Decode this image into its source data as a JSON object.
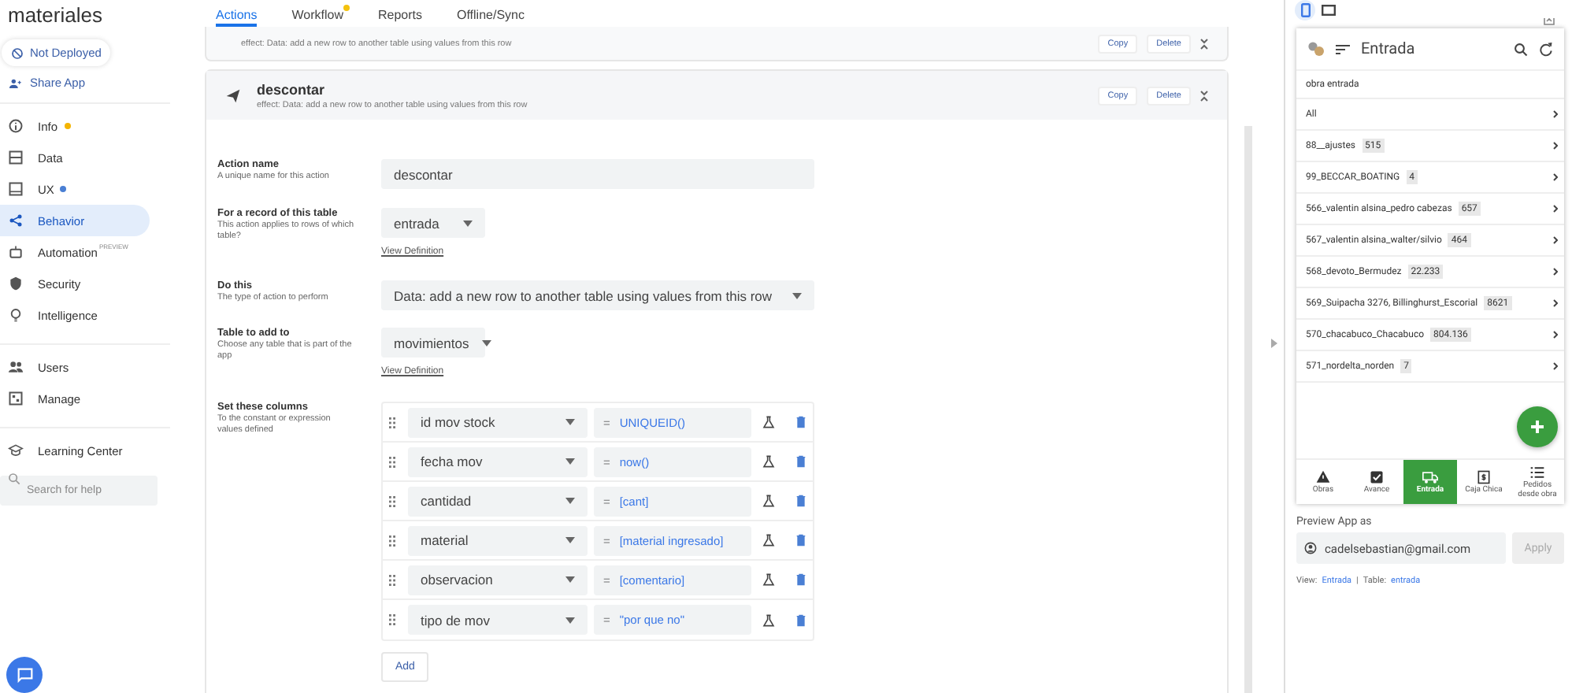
{
  "app_title": "materiales",
  "deploy_status": "Not Deployed",
  "share_label": "Share App",
  "nav_sections": [
    {
      "items": [
        {
          "label": "Info",
          "selected": false,
          "color": "#f4b400"
        },
        {
          "label": "Data",
          "selected": false
        },
        {
          "label": "UX",
          "selected": false,
          "color": "#4a7fd4"
        },
        {
          "label": "Behavior",
          "selected": true
        },
        {
          "label": "Automation",
          "selected": false,
          "tag": "PREVIEW"
        },
        {
          "label": "Security",
          "selected": false
        },
        {
          "label": "Intelligence",
          "selected": false
        }
      ]
    },
    {
      "items": [
        {
          "label": "Users",
          "selected": false
        },
        {
          "label": "Manage",
          "selected": false
        }
      ]
    },
    {
      "items": [
        {
          "label": "Learning Center",
          "selected": false
        }
      ]
    }
  ],
  "help_search": {
    "placeholder": "Search for help"
  },
  "tabs": [
    {
      "label": "Actions",
      "selected": true
    },
    {
      "label": "Workflow",
      "selected": false,
      "color": "#f4c20d"
    },
    {
      "label": "Reports",
      "selected": false
    },
    {
      "label": "Offline/Sync",
      "selected": false
    }
  ],
  "actions": [
    {
      "kind": "collapsed",
      "effect": "effect: Data: add a new row to another table using values from this row",
      "buttons": [
        "Copy",
        "Delete"
      ]
    },
    {
      "kind": "expanded",
      "name": "descontar",
      "effect": "effect: Data: add a new row to another table using values from this row",
      "buttons": [
        "Copy",
        "Delete"
      ],
      "fields": [
        {
          "kind": "text",
          "label": "Action name",
          "hint": "A unique name for this action",
          "value": "descontar"
        },
        {
          "kind": "dropdown",
          "label": "For a record of this table",
          "hint": "This action applies to rows of which table?",
          "value": "entrada",
          "link": "View Definition"
        },
        {
          "kind": "wide-dropdown",
          "label": "Do this",
          "hint": "The type of action to perform",
          "value": "Data: add a new row to another table using values from this row"
        },
        {
          "kind": "dropdown",
          "label": "Table to add to",
          "hint": "Choose any table that is part of the app",
          "value": "movimientos",
          "link": "View Definition"
        },
        {
          "kind": "columns",
          "label": "Set these columns",
          "hint": "To the constant or expression values defined",
          "rows": [
            {
              "column": "id mov stock",
              "operator": "=",
              "value": "UNIQUEID()"
            },
            {
              "column": "fecha mov",
              "operator": "=",
              "value": "now()"
            },
            {
              "column": "cantidad",
              "operator": "=",
              "value": "[cant]"
            },
            {
              "column": "material",
              "operator": "=",
              "value": "[material ingresado]"
            },
            {
              "column": "observacion",
              "operator": "=",
              "value": "[comentario]"
            },
            {
              "column": "tipo de mov",
              "operator": "=",
              "value": "\"por que no\""
            }
          ],
          "add_label": "Add"
        }
      ]
    }
  ],
  "preview": {
    "devices": [
      {
        "kind": "phone",
        "selected": true
      },
      {
        "kind": "tablet",
        "selected": false
      }
    ],
    "view_title": "Entrada",
    "group_label": "obra entrada",
    "groups": [
      {
        "name": "All"
      },
      {
        "name": "88__ajustes",
        "count": "515"
      },
      {
        "name": "99_BECCAR_BOATING",
        "count": "4"
      },
      {
        "name": "566_valentin alsina_pedro cabezas",
        "count": "657"
      },
      {
        "name": "567_valentin alsina_walter/silvio",
        "count": "464"
      },
      {
        "name": "568_devoto_Bermudez",
        "count": "22.233"
      },
      {
        "name": "569_Suipacha 3276, Billinghurst_Escorial",
        "count": "8621"
      },
      {
        "name": "570_chacabuco_Chacabuco",
        "count": "804.136"
      },
      {
        "name": "571_nordelta_norden",
        "count": "7"
      }
    ],
    "bottom_nav": [
      {
        "label": "Obras",
        "selected": false
      },
      {
        "label": "Avance",
        "selected": false
      },
      {
        "label": "Entrada",
        "selected": true
      },
      {
        "label": "Caja Chica",
        "selected": false
      },
      {
        "label": "Pedidos desde obra",
        "selected": false
      }
    ],
    "preview_as_label": "Preview App as",
    "preview_as_value": "cadelsebastian@gmail.com",
    "apply": {
      "label": "Apply",
      "disabled": true
    },
    "footer": [
      {
        "kind": "label",
        "text": "View:"
      },
      {
        "kind": "link",
        "text": "Entrada"
      },
      {
        "kind": "sep",
        "text": "|"
      },
      {
        "kind": "label",
        "text": "Table:"
      },
      {
        "kind": "link",
        "text": "entrada"
      }
    ]
  }
}
